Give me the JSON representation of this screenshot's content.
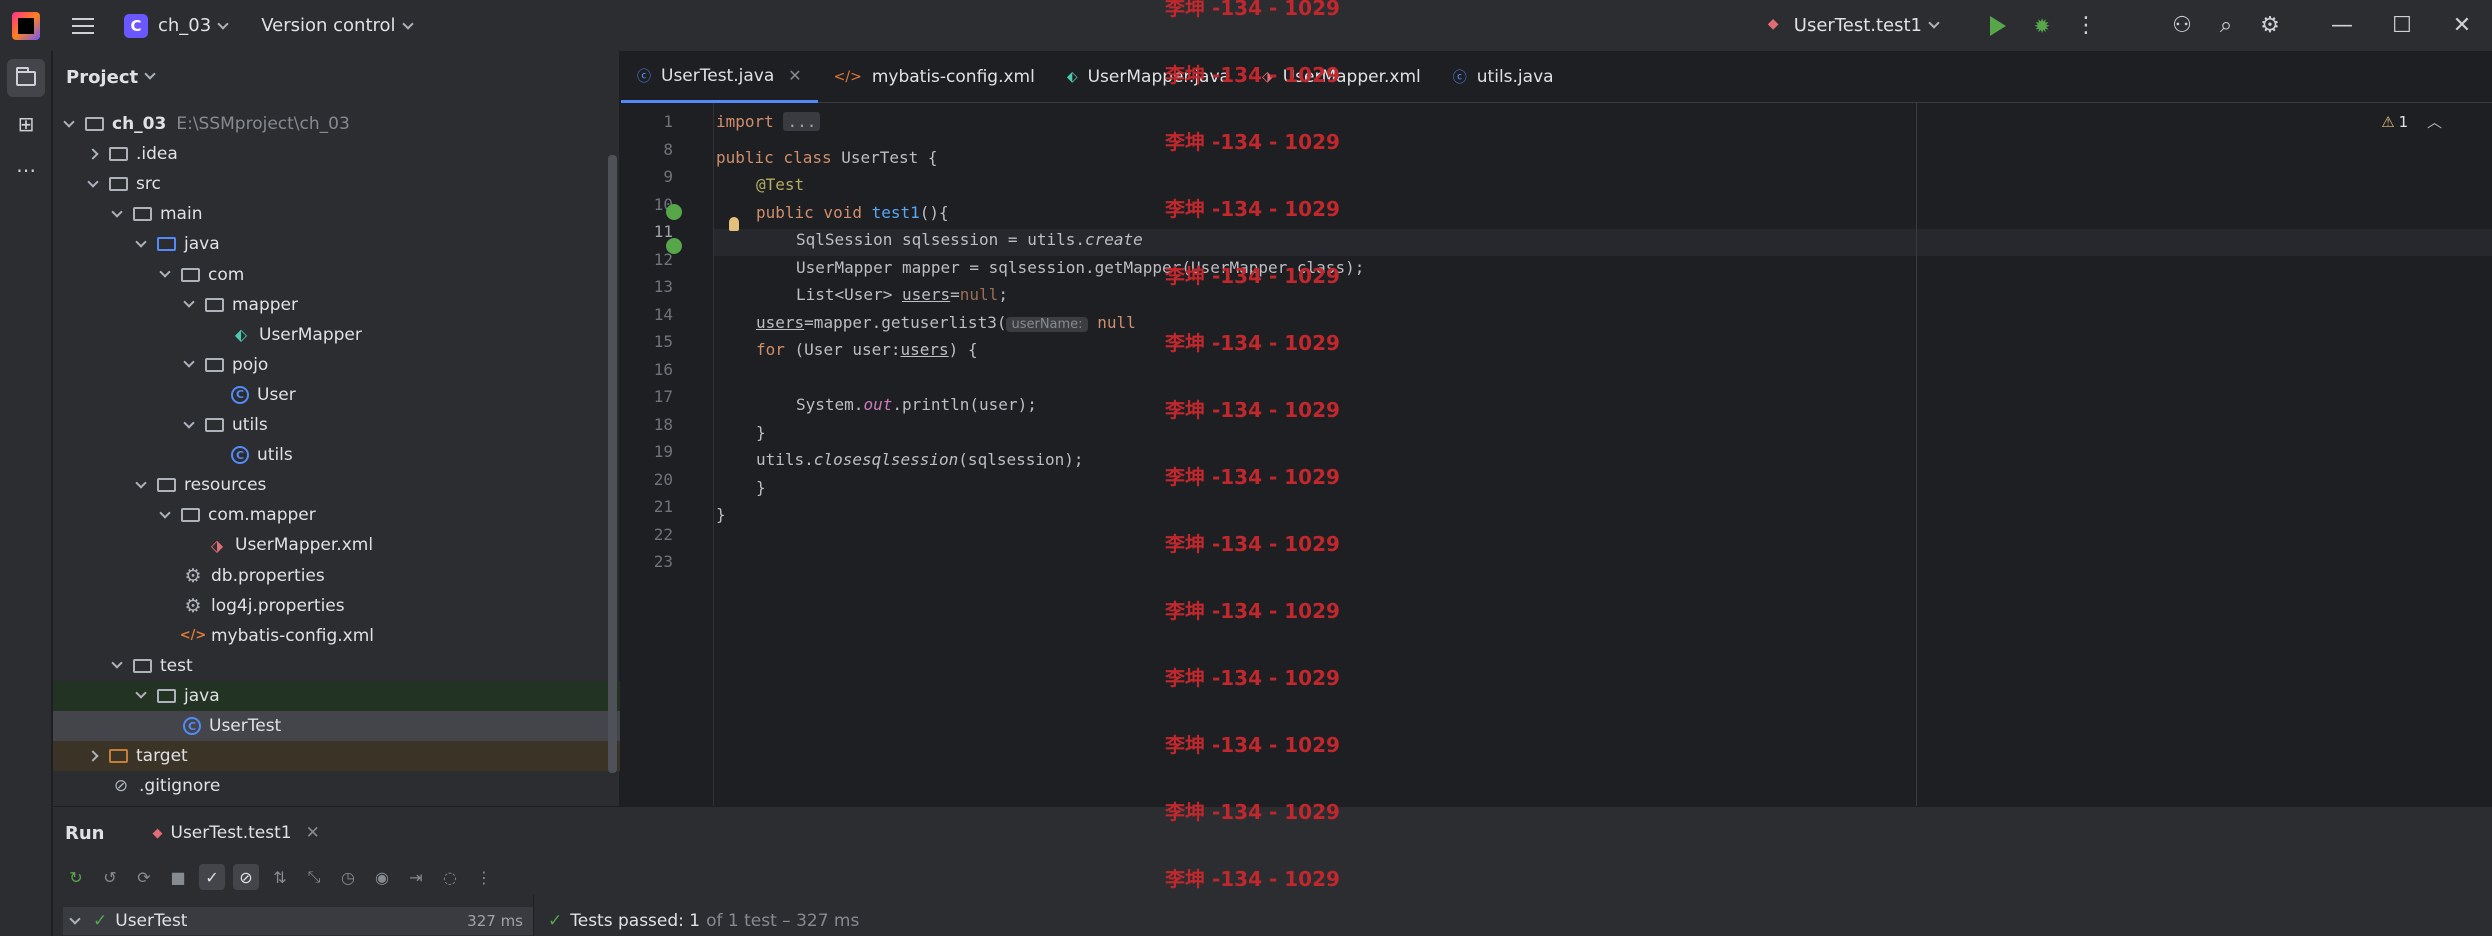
{
  "titlebar": {
    "project_badge": "C",
    "project_name": "ch_03",
    "version_control": "Version control",
    "run_config": "UserTest.test1"
  },
  "project_panel": {
    "title": "Project",
    "tree": [
      {
        "label": "ch_03",
        "sub": "E:\\SSMproject\\ch_03",
        "depth": 0,
        "arrow": "open",
        "icon": "module-folder-icon",
        "bold": true
      },
      {
        "label": ".idea",
        "depth": 1,
        "arrow": "closed",
        "icon": "folder-icon"
      },
      {
        "label": "src",
        "depth": 1,
        "arrow": "open",
        "icon": "folder-icon"
      },
      {
        "label": "main",
        "depth": 2,
        "arrow": "open",
        "icon": "folder-icon"
      },
      {
        "label": "java",
        "depth": 3,
        "arrow": "open",
        "icon": "source-folder-icon"
      },
      {
        "label": "com",
        "depth": 4,
        "arrow": "open",
        "icon": "package-icon"
      },
      {
        "label": "mapper",
        "depth": 5,
        "arrow": "open",
        "icon": "package-icon"
      },
      {
        "label": "UserMapper",
        "depth": 6,
        "arrow": "none",
        "icon": "mapper-interface-icon"
      },
      {
        "label": "pojo",
        "depth": 5,
        "arrow": "open",
        "icon": "package-icon"
      },
      {
        "label": "User",
        "depth": 6,
        "arrow": "none",
        "icon": "class-icon"
      },
      {
        "label": "utils",
        "depth": 5,
        "arrow": "open",
        "icon": "package-icon"
      },
      {
        "label": "utils",
        "depth": 6,
        "arrow": "none",
        "icon": "class-icon"
      },
      {
        "label": "resources",
        "depth": 3,
        "arrow": "open",
        "icon": "resources-folder-icon"
      },
      {
        "label": "com.mapper",
        "depth": 4,
        "arrow": "open",
        "icon": "folder-icon"
      },
      {
        "label": "UserMapper.xml",
        "depth": 5,
        "arrow": "none",
        "icon": "mybatis-xml-icon"
      },
      {
        "label": "db.properties",
        "depth": 4,
        "arrow": "none",
        "icon": "properties-gear-icon"
      },
      {
        "label": "log4j.properties",
        "depth": 4,
        "arrow": "none",
        "icon": "properties-gear-icon"
      },
      {
        "label": "mybatis-config.xml",
        "depth": 4,
        "arrow": "none",
        "icon": "xml-file-icon"
      },
      {
        "label": "test",
        "depth": 2,
        "arrow": "open",
        "icon": "folder-icon"
      },
      {
        "label": "java",
        "depth": 3,
        "arrow": "open",
        "icon": "test-source-folder-icon"
      },
      {
        "label": "UserTest",
        "depth": 4,
        "arrow": "none",
        "icon": "class-icon"
      },
      {
        "label": "target",
        "depth": 1,
        "arrow": "closed",
        "icon": "excluded-folder-icon"
      },
      {
        "label": ".gitignore",
        "depth": 1,
        "arrow": "none",
        "icon": "ignore-file-icon"
      }
    ]
  },
  "editor": {
    "tabs": [
      {
        "label": "UserTest.java",
        "icon": "class-icon",
        "active": true,
        "closable": true
      },
      {
        "label": "mybatis-config.xml",
        "icon": "xml-file-icon"
      },
      {
        "label": "UserMapper.java",
        "icon": "mapper-interface-icon"
      },
      {
        "label": "UserMapper.xml",
        "icon": "mybatis-xml-icon"
      },
      {
        "label": "utils.java",
        "icon": "class-icon"
      }
    ],
    "line_numbers": [
      "1",
      "8",
      "9",
      "10",
      "11",
      "12",
      "13",
      "14",
      "15",
      "16",
      "17",
      "18",
      "19",
      "20",
      "21",
      "22",
      "23"
    ],
    "current_line": "11",
    "warning_count": "1",
    "code": {
      "l1_import": "import",
      "l1_fold": "...",
      "l9_kw": "public class",
      "l9_rest": " UserTest {",
      "l10_ann": "@Test",
      "l11_kw": "public void",
      "l11_fn": "test1",
      "l11_rest": "(){",
      "l12_a": "SqlSession sqlsession = utils.",
      "l12_b": "create",
      "l13": "UserMapper mapper = sqlsession.getMapper(UserMapper.class);",
      "l14_a": "List<User> ",
      "l14_b": "users",
      "l14_c": "=",
      "l14_d": "null",
      "l14_e": ";",
      "l15_a": "users",
      "l15_b": "=mapper.getuserlist3(",
      "l15_hint": "userName:",
      "l15_c": " null",
      "l16_kw": "for",
      "l16_a": " (User user:",
      "l16_b": "users",
      "l16_c": ") {",
      "l18_a": "System.",
      "l18_b": "out",
      "l18_c": ".println(user);",
      "l19": "}",
      "l20_a": "utils.",
      "l20_b": "closesqlsession",
      "l20_c": "(sqlsession);",
      "l21": "}",
      "l22": "}"
    }
  },
  "run_panel": {
    "title": "Run",
    "tab_label": "UserTest.test1",
    "tree_item": "UserTest",
    "tree_time": "327 ms",
    "status_main": "Tests passed: 1",
    "status_rest": "of 1 test – 327 ms"
  },
  "watermark": {
    "text": "李坤 -134 - 1029",
    "count": 14
  },
  "colors": {
    "accent": "#548af7",
    "success": "#57a64a",
    "watermark": "#c0282d",
    "background": "#1e1f22",
    "panel": "#2b2d30"
  }
}
